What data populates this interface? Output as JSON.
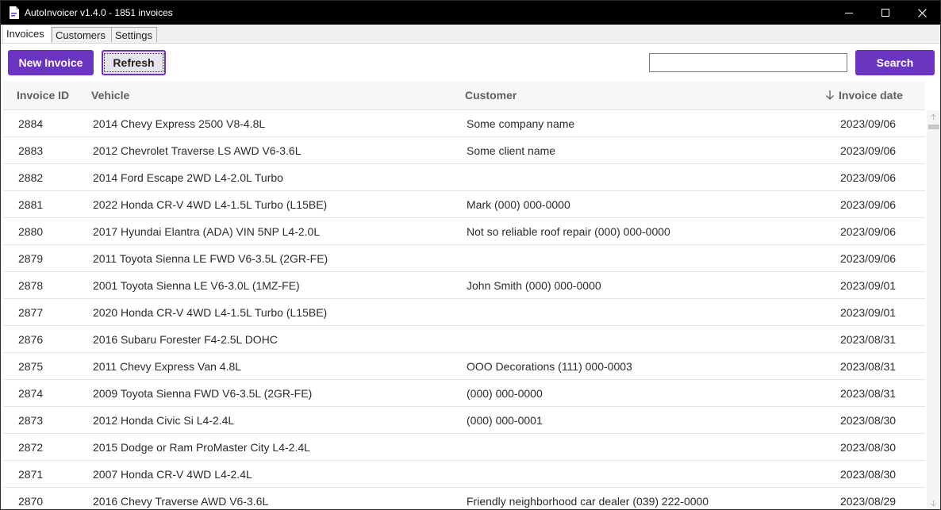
{
  "window": {
    "title": "AutoInvoicer v1.4.0 - 1851 invoices"
  },
  "tabs": [
    {
      "label": "Invoices"
    },
    {
      "label": "Customers"
    },
    {
      "label": "Settings"
    }
  ],
  "toolbar": {
    "new_invoice_label": "New Invoice",
    "refresh_label": "Refresh",
    "search_value": "",
    "search_label": "Search"
  },
  "table": {
    "columns": {
      "id": "Invoice ID",
      "vehicle": "Vehicle",
      "customer": "Customer",
      "date": "Invoice date"
    },
    "sort": {
      "column": "date",
      "direction": "descending",
      "icon": "arrow-down-icon"
    },
    "rows": [
      {
        "id": "2884",
        "vehicle": "2014 Chevy Express 2500 V8-4.8L",
        "customer": "Some company name",
        "date": "2023/09/06"
      },
      {
        "id": "2883",
        "vehicle": "2012 Chevrolet Traverse LS AWD V6-3.6L",
        "customer": "Some client name",
        "date": "2023/09/06"
      },
      {
        "id": "2882",
        "vehicle": "2014 Ford Escape 2WD L4-2.0L Turbo",
        "customer": "",
        "date": "2023/09/06"
      },
      {
        "id": "2881",
        "vehicle": "2022 Honda CR-V 4WD L4-1.5L Turbo (L15BE)",
        "customer": "Mark (000) 000-0000",
        "date": "2023/09/06"
      },
      {
        "id": "2880",
        "vehicle": "2017 Hyundai Elantra (ADA) VIN 5NP L4-2.0L",
        "customer": "Not so reliable roof repair (000) 000-0000",
        "date": "2023/09/06"
      },
      {
        "id": "2879",
        "vehicle": "2011 Toyota Sienna LE FWD V6-3.5L (2GR-FE)",
        "customer": "",
        "date": "2023/09/06"
      },
      {
        "id": "2878",
        "vehicle": "2001 Toyota Sienna LE V6-3.0L (1MZ-FE)",
        "customer": "John Smith (000) 000-0000",
        "date": "2023/09/01"
      },
      {
        "id": "2877",
        "vehicle": "2020 Honda CR-V 4WD L4-1.5L Turbo (L15BE)",
        "customer": "",
        "date": "2023/09/01"
      },
      {
        "id": "2876",
        "vehicle": "2016 Subaru Forester F4-2.5L DOHC",
        "customer": "",
        "date": "2023/08/31"
      },
      {
        "id": "2875",
        "vehicle": "2011 Chevy Express Van 4.8L",
        "customer": "OOO Decorations (111) 000-0003",
        "date": "2023/08/31"
      },
      {
        "id": "2874",
        "vehicle": "2009 Toyota Sienna FWD V6-3.5L (2GR-FE)",
        "customer": "(000) 000-0000",
        "date": "2023/08/31"
      },
      {
        "id": "2873",
        "vehicle": "2012 Honda Civic Si L4-2.4L",
        "customer": "(000) 000-0001",
        "date": "2023/08/30"
      },
      {
        "id": "2872",
        "vehicle": "2015 Dodge or Ram ProMaster City L4-2.4L",
        "customer": "",
        "date": "2023/08/30"
      },
      {
        "id": "2871",
        "vehicle": "2007 Honda CR-V 4WD L4-2.4L",
        "customer": "",
        "date": "2023/08/30"
      },
      {
        "id": "2870",
        "vehicle": "2016 Chevy Traverse AWD V6-3.6L",
        "customer": "Friendly neighborhood car dealer (039) 222-0000",
        "date": "2023/08/29"
      }
    ]
  },
  "colors": {
    "accent": "#6b35c2",
    "titlebar": "#000000",
    "header_bg": "#f7f7f7",
    "row_border": "#e4e4e4"
  }
}
